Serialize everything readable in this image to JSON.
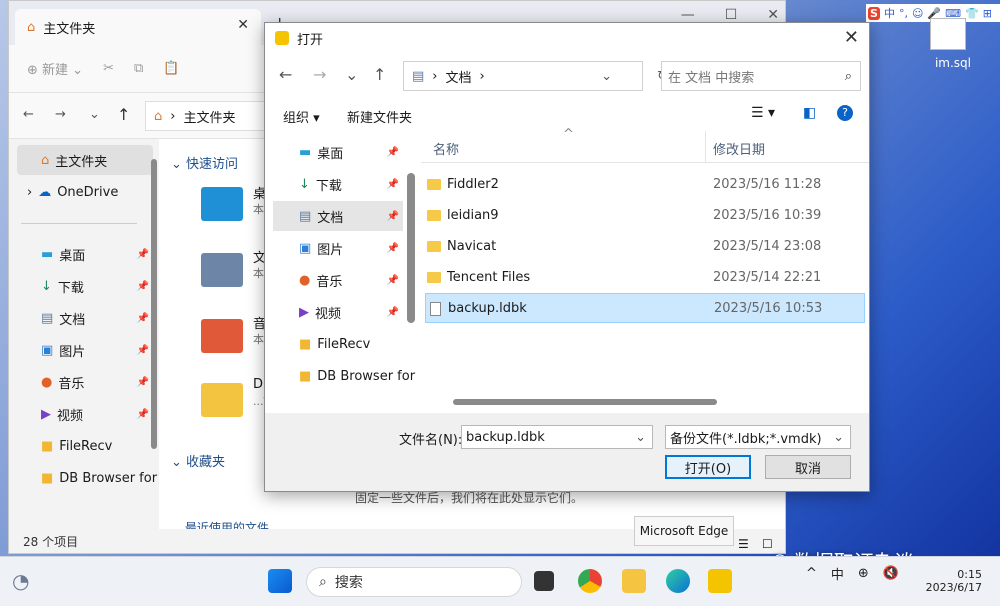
{
  "explorer": {
    "tab_title": "主文件夹",
    "toolbar_new": "新建",
    "address": "主文件夹",
    "nav_home": "主文件夹",
    "nav_onedrive": "OneDrive",
    "nav_items": [
      "桌面",
      "下载",
      "文档",
      "图片",
      "音乐",
      "视频",
      "FileRecv",
      "DB Browser for"
    ],
    "content": {
      "quick_access": "快速访问",
      "favorites": "收藏夹",
      "recent": "最近使用的文件",
      "favorites_hint": "固定一些文件后，我们将在此处显示它们。",
      "tile_labels": [
        "桌",
        "文",
        "音",
        "DE"
      ],
      "tile_sub": [
        "本",
        "本",
        "本",
        "...\\"
      ]
    },
    "status": "28 个项目"
  },
  "dialog": {
    "title": "打开",
    "path": "文档",
    "search_placeholder": "在 文档 中搜索",
    "organize": "组织",
    "new_folder": "新建文件夹",
    "nav_items": [
      "桌面",
      "下载",
      "文档",
      "图片",
      "音乐",
      "视频",
      "FileRecv",
      "DB Browser for"
    ],
    "col_name": "名称",
    "col_date": "修改日期",
    "files": [
      {
        "name": "Fiddler2",
        "date": "2023/5/16 11:28",
        "type": "folder"
      },
      {
        "name": "leidian9",
        "date": "2023/5/16 10:39",
        "type": "folder"
      },
      {
        "name": "Navicat",
        "date": "2023/5/14 23:08",
        "type": "folder"
      },
      {
        "name": "Tencent Files",
        "date": "2023/5/14 22:21",
        "type": "folder"
      },
      {
        "name": "backup.ldbk",
        "date": "2023/5/16 10:53",
        "type": "file"
      }
    ],
    "filename_label": "文件名(N):",
    "filename_value": "backup.ldbk",
    "filetype": "备份文件(*.ldbk;*.vmdk)",
    "open_button": "打开(O)",
    "cancel_button": "取消"
  },
  "desktop": {
    "file_label": "im.sql"
  },
  "ime": {
    "lang": "中"
  },
  "taskbar": {
    "search": "搜索",
    "tooltip": "Microsoft Edge",
    "tray_lang": "中",
    "time": "0:15",
    "date": "2023/6/17"
  },
  "watermark": "数据取证杂谈"
}
